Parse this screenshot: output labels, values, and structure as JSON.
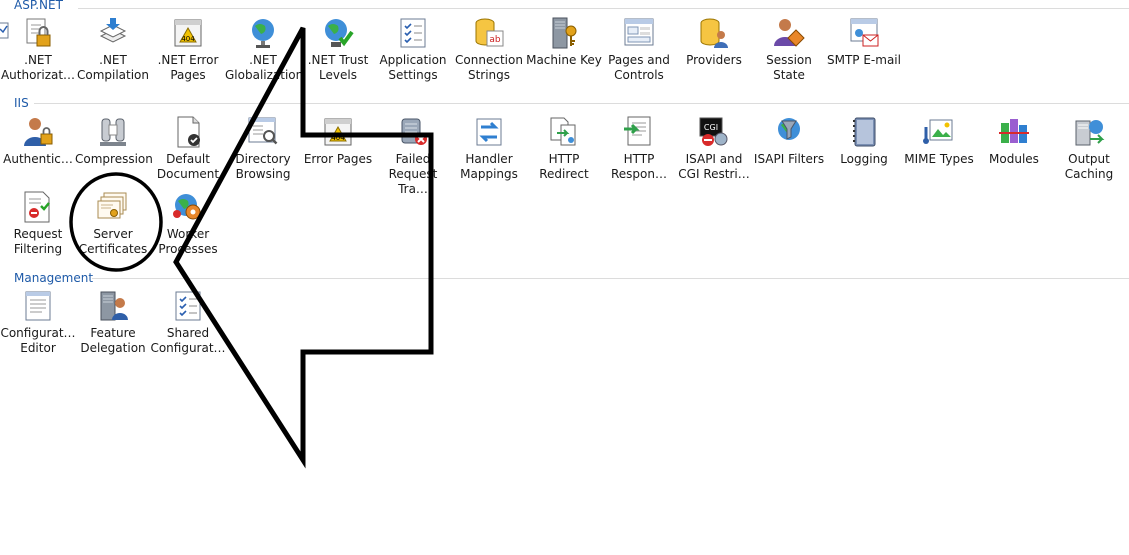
{
  "sections": {
    "aspnet": "ASP.NET",
    "iis": "IIS",
    "management": "Management"
  },
  "aspnet_items": [
    {
      "label": ".NET\nAuthorizat…",
      "icon": "lock-icon"
    },
    {
      "label": ".NET\nCompilation",
      "icon": "stacked-pages-icon"
    },
    {
      "label": ".NET Error\nPages",
      "icon": "error-404-icon"
    },
    {
      "label": ".NET\nGlobalization",
      "icon": "globe-icon"
    },
    {
      "label": ".NET Trust\nLevels",
      "icon": "globe-check-icon"
    },
    {
      "label": "Application\nSettings",
      "icon": "checklist-icon"
    },
    {
      "label": "Connection\nStrings",
      "icon": "database-text-icon"
    },
    {
      "label": "Machine Key",
      "icon": "server-key-icon"
    },
    {
      "label": "Pages and\nControls",
      "icon": "pages-controls-icon"
    },
    {
      "label": "Providers",
      "icon": "database-users-icon"
    },
    {
      "label": "Session State",
      "icon": "user-session-icon"
    },
    {
      "label": "SMTP E-mail",
      "icon": "email-icon"
    }
  ],
  "iis_row1": [
    {
      "label": "Authentic…",
      "icon": "user-lock-icon"
    },
    {
      "label": "Compression",
      "icon": "vise-icon"
    },
    {
      "label": "Default\nDocument",
      "icon": "document-check-icon"
    },
    {
      "label": "Directory\nBrowsing",
      "icon": "directory-browse-icon"
    },
    {
      "label": "Error Pages",
      "icon": "error-404-icon"
    },
    {
      "label": "Failed\nRequest Tra…",
      "icon": "failed-request-icon"
    },
    {
      "label": "Handler\nMappings",
      "icon": "handler-arrows-icon"
    },
    {
      "label": "HTTP\nRedirect",
      "icon": "redirect-icon"
    },
    {
      "label": "HTTP\nRespon…",
      "icon": "response-headers-icon"
    },
    {
      "label": "ISAPI and\nCGI Restri…",
      "icon": "cgi-restrict-icon"
    },
    {
      "label": "ISAPI Filters",
      "icon": "globe-filter-icon"
    },
    {
      "label": "Logging",
      "icon": "log-book-icon"
    },
    {
      "label": "MIME Types",
      "icon": "mime-types-icon"
    },
    {
      "label": "Modules",
      "icon": "modules-icon"
    },
    {
      "label": "Output\nCaching",
      "icon": "output-cache-icon"
    }
  ],
  "iis_row2": [
    {
      "label": "Request\nFiltering",
      "icon": "request-filter-icon"
    },
    {
      "label": "Server\nCertificates",
      "icon": "certificates-icon"
    },
    {
      "label": "Worker\nProcesses",
      "icon": "worker-processes-icon"
    }
  ],
  "management_items": [
    {
      "label": "Configurat…\nEditor",
      "icon": "config-editor-icon"
    },
    {
      "label": "Feature\nDelegation",
      "icon": "feature-delegation-icon"
    },
    {
      "label": "Shared\nConfigurat…",
      "icon": "shared-config-icon"
    }
  ],
  "annotation": {
    "icon": "arrow-annotation",
    "circle": "highlight-circle"
  }
}
